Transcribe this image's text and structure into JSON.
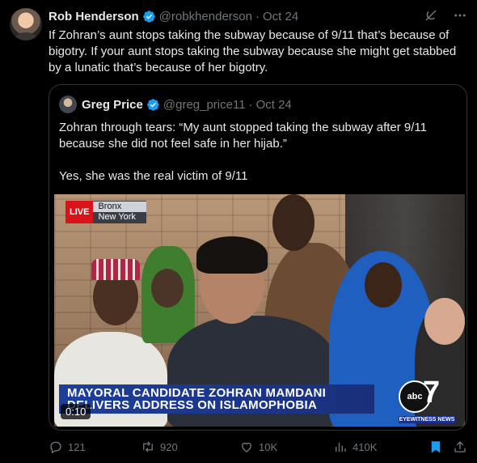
{
  "tweet": {
    "author_name": "Rob Henderson",
    "handle": "@robkhenderson",
    "separator": "·",
    "date": "Oct 24",
    "text": "If Zohran’s aunt stops taking the subway because of 9/11 that’s because of bigotry. If your aunt stops taking the subway because she might get stabbed by a lunatic that’s because of her bigotry."
  },
  "quote": {
    "author_name": "Greg Price",
    "handle": "@greg_price11",
    "separator": "·",
    "date": "Oct 24",
    "text_p1": "Zohran through tears: “My aunt stopped taking the subway after 9/11 because she did not feel safe in her hijab.”",
    "text_p2": "Yes, she was the real victim of 9/11",
    "video": {
      "live_label": "LIVE",
      "location_line1": "Bronx",
      "location_line2": "New York",
      "headline_line1": "MAYORAL CANDIDATE ZOHRAN MAMDANI",
      "headline_line2": "DELIVERS ADDRESS ON ISLAMOPHOBIA",
      "logo_text": "abc",
      "logo_number": "7",
      "logo_tagline": "EYEWITNESS NEWS",
      "timer": "0:10"
    }
  },
  "actions": {
    "replies": "121",
    "reposts": "920",
    "likes": "10K",
    "views": "410K"
  },
  "colors": {
    "background": "#000000",
    "text": "#e7e9ea",
    "muted": "#71767b",
    "verified": "#1d9bf0",
    "bookmark": "#1d9bf0"
  }
}
